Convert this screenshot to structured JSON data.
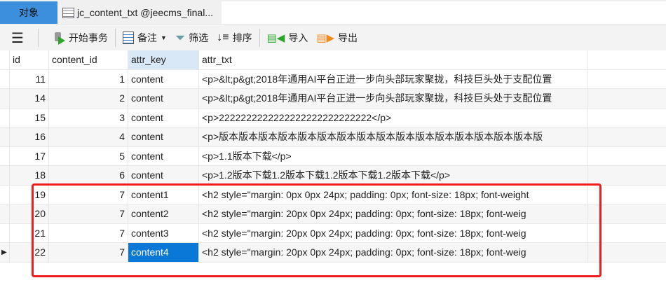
{
  "tabs": {
    "objects": "对象",
    "table_tab": "jc_content_txt @jeecms_final..."
  },
  "toolbar": {
    "begin_tx": "开始事务",
    "note": "备注",
    "filter": "筛选",
    "sort": "排序",
    "import": "导入",
    "export": "导出"
  },
  "columns": [
    "id",
    "content_id",
    "attr_key",
    "attr_txt"
  ],
  "rows": [
    {
      "id": "11",
      "content_id": "1",
      "attr_key": "content",
      "attr_txt": "<p>&lt;p&gt;2018年通用AI平台正进一步向头部玩家聚拢，科技巨头处于支配位置"
    },
    {
      "id": "14",
      "content_id": "2",
      "attr_key": "content",
      "attr_txt": "<p>&lt;p&gt;2018年通用AI平台正进一步向头部玩家聚拢，科技巨头处于支配位置"
    },
    {
      "id": "15",
      "content_id": "3",
      "attr_key": "content",
      "attr_txt": "<p>2222222222222222222222222222</p>"
    },
    {
      "id": "16",
      "content_id": "4",
      "attr_key": "content",
      "attr_txt": "<p>版本版本版本版本版本版本版本版本版本版本版本版本版本版本版本版本版"
    },
    {
      "id": "17",
      "content_id": "5",
      "attr_key": "content",
      "attr_txt": "<p>1.1版本下载</p>"
    },
    {
      "id": "18",
      "content_id": "6",
      "attr_key": "content",
      "attr_txt": "<p>1.2版本下载1.2版本下载1.2版本下载1.2版本下载</p>"
    },
    {
      "id": "19",
      "content_id": "7",
      "attr_key": "content1",
      "attr_txt": "<h2 style=\"margin: 0px 0px 24px; padding: 0px; font-size: 18px; font-weight"
    },
    {
      "id": "20",
      "content_id": "7",
      "attr_key": "content2",
      "attr_txt": "<h2 style=\"margin: 20px 0px 24px; padding: 0px; font-size: 18px; font-weig"
    },
    {
      "id": "21",
      "content_id": "7",
      "attr_key": "content3",
      "attr_txt": "<h2 style=\"margin: 20px 0px 24px; padding: 0px; font-size: 18px; font-weig"
    },
    {
      "id": "22",
      "content_id": "7",
      "attr_key": "content4",
      "attr_txt": "<h2 style=\"margin: 20px 0px 24px; padding: 0px; font-size: 18px; font-weig"
    }
  ],
  "colors": {
    "accent": "#0a78d7",
    "highlight": "#f21c1c"
  }
}
